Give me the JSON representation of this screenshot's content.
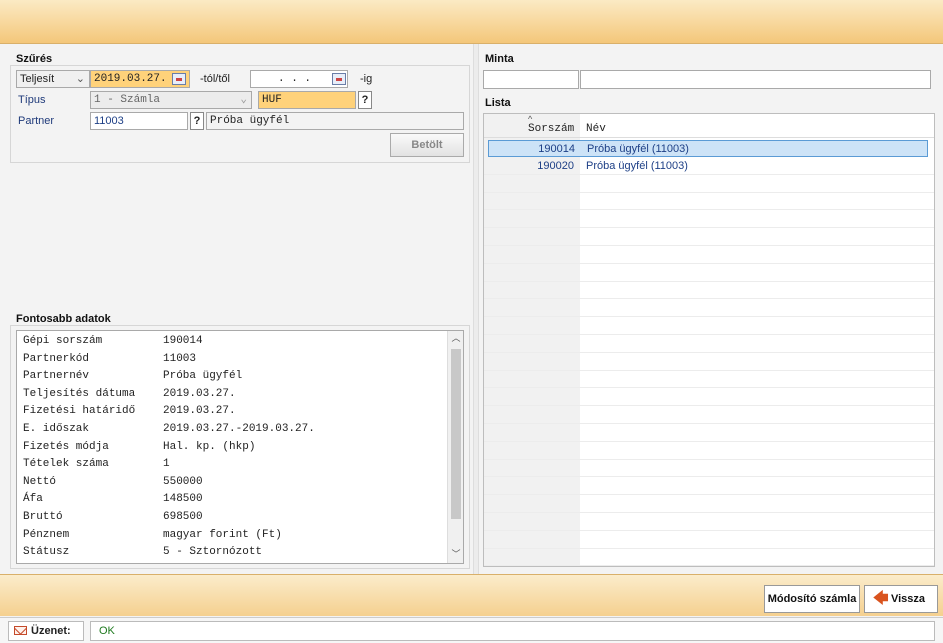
{
  "colors": {
    "accent": "#f4c77a",
    "highlight_field": "#ffd27a",
    "selected_row": "#cde3f7"
  },
  "filter": {
    "title": "Szűrés",
    "date_type": "Teljesít",
    "date_from": "2019.03.27.",
    "from_suffix": "-tól/től",
    "date_to": " .  .  .",
    "to_suffix": "-ig",
    "type_label": "Típus",
    "type_value": "1 - Számla",
    "currency": "HUF",
    "partner_label": "Partner",
    "partner_code": "11003",
    "partner_name": "Próba ügyfél",
    "load_button": "Betölt",
    "question": "?"
  },
  "sample": {
    "title": "Minta"
  },
  "list": {
    "title": "Lista",
    "col_number": "Sorszám",
    "col_name": "Név",
    "rows": [
      {
        "number": "190014",
        "name": "Próba ügyfél (11003)"
      },
      {
        "number": "190020",
        "name": "Próba ügyfél (11003)"
      }
    ]
  },
  "details": {
    "title": "Fontosabb adatok",
    "rows": [
      {
        "key": "Gépi sorszám",
        "value": "190014"
      },
      {
        "key": "Partnerkód",
        "value": "11003"
      },
      {
        "key": "Partnernév",
        "value": "Próba ügyfél"
      },
      {
        "key": "Teljesítés dátuma",
        "value": "2019.03.27."
      },
      {
        "key": "Fizetési határidő",
        "value": "2019.03.27."
      },
      {
        "key": "E. időszak",
        "value": "2019.03.27.-2019.03.27."
      },
      {
        "key": "Fizetés módja",
        "value": "Hal. kp. (hkp)"
      },
      {
        "key": "Tételek száma",
        "value": "1"
      },
      {
        "key": "Nettó",
        "value": "550000"
      },
      {
        "key": "Áfa",
        "value": "148500"
      },
      {
        "key": "Bruttó",
        "value": "698500"
      },
      {
        "key": "Pénznem",
        "value": "magyar forint (Ft)"
      },
      {
        "key": "Státusz",
        "value": "5 - Sztornózott"
      }
    ]
  },
  "actions": {
    "modify": "Módosító számla",
    "back": "Vissza"
  },
  "status": {
    "label": "Üzenet:",
    "value": "OK"
  },
  "icons": [
    "calendar-icon",
    "chevron-down-icon",
    "sort-caret-icon",
    "mail-icon",
    "back-arrow-icon",
    "scroll-up-icon",
    "scroll-down-icon"
  ]
}
